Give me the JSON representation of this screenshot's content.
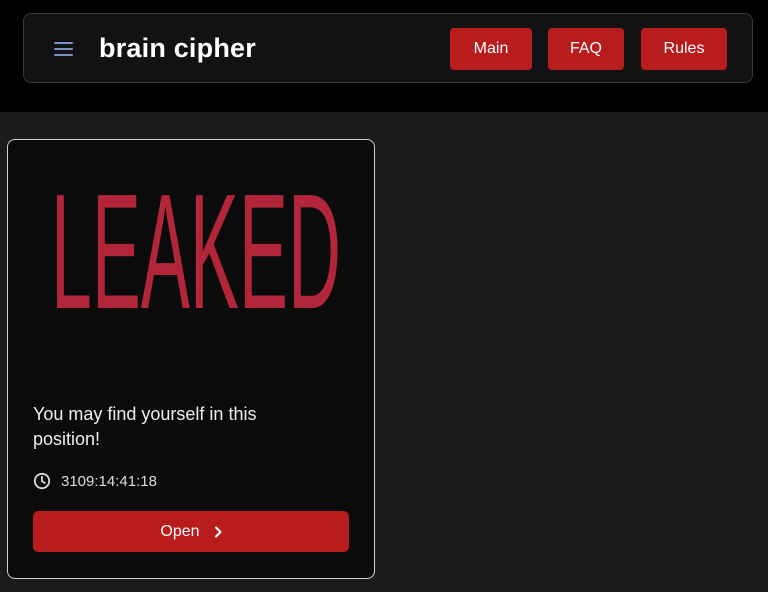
{
  "header": {
    "brand": "brain cipher",
    "menu_icon": "hamburger-menu-icon",
    "nav": [
      {
        "label": "Main"
      },
      {
        "label": "FAQ"
      },
      {
        "label": "Rules"
      }
    ]
  },
  "card": {
    "image_text": "LEAKED",
    "description": "You may find yourself in this position!",
    "timer_icon": "clock-icon",
    "timer": "3109:14:41:18",
    "open_button": {
      "label": "Open",
      "icon": "chevron-right-icon"
    }
  },
  "colors": {
    "accent": "#b81c1c",
    "leaked_text": "#b3263a",
    "page_bg": "#1b1b1d",
    "header_bg": "#000000",
    "card_border": "#d0d0d4"
  }
}
